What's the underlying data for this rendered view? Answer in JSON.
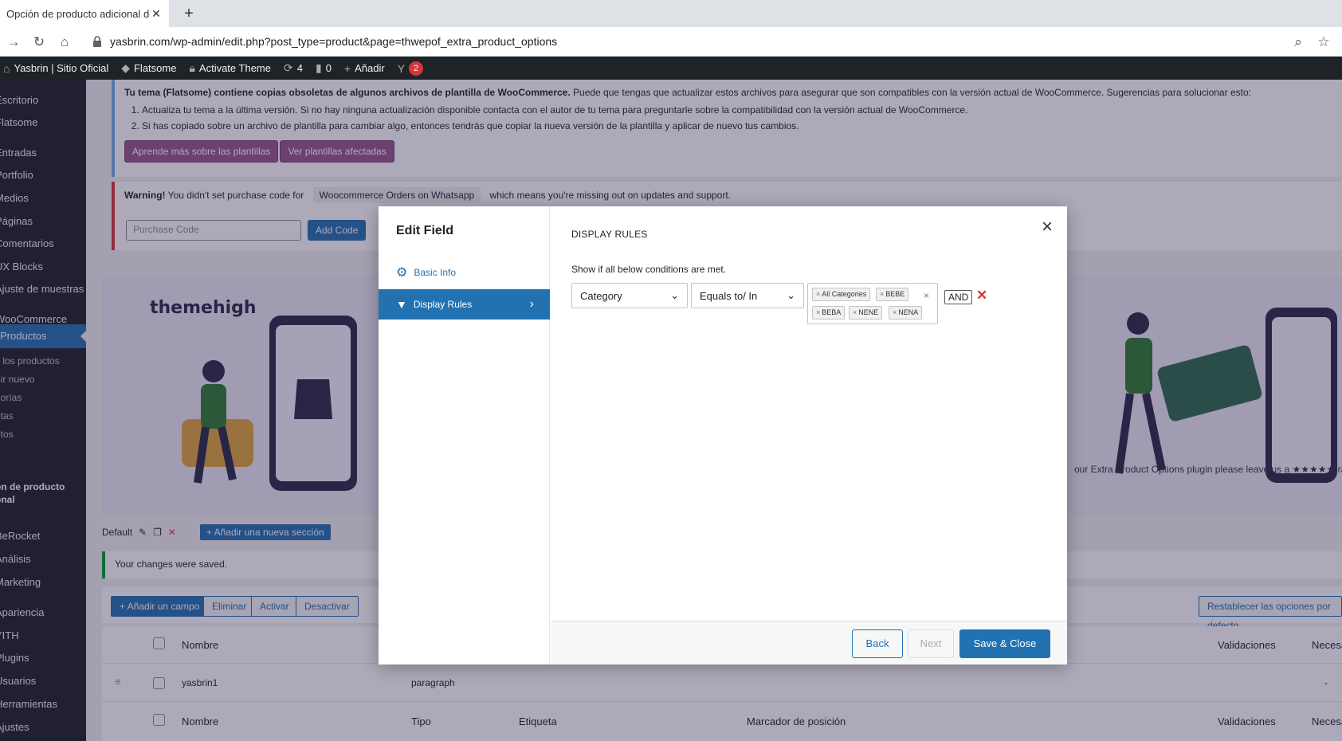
{
  "browser": {
    "tab_title": "Opción de producto adicional de",
    "url": "yasbrin.com/wp-admin/edit.php?post_type=product&page=thwepof_extra_product_options"
  },
  "adminbar": {
    "site": "Yasbrin | Sitio Oficial",
    "theme": "Flatsome",
    "activate": "Activate Theme",
    "updates": "4",
    "comments": "0",
    "add": "Añadir",
    "yoast_badge": "2"
  },
  "sidebar": {
    "items": [
      {
        "label": "Escritorio"
      },
      {
        "label": "Flatsome"
      },
      {
        "label": "Entradas"
      },
      {
        "label": "Portfolio"
      },
      {
        "label": "Medios"
      },
      {
        "label": "Páginas"
      },
      {
        "label": "Comentarios"
      },
      {
        "label": "UX Blocks"
      },
      {
        "label": "Ajuste de muestras"
      },
      {
        "label": "WooCommerce"
      },
      {
        "label": "Productos"
      },
      {
        "label": "s los productos"
      },
      {
        "label": "dir nuevo"
      },
      {
        "label": "gorías"
      },
      {
        "label": "etas"
      },
      {
        "label": "utos"
      },
      {
        "label": "ón de producto"
      },
      {
        "label": "onal"
      },
      {
        "label": "BeRocket"
      },
      {
        "label": "Análisis"
      },
      {
        "label": "Marketing"
      },
      {
        "label": "Apariencia"
      },
      {
        "label": "YITH"
      },
      {
        "label": "Plugins"
      },
      {
        "label": "Usuarios"
      },
      {
        "label": "Herramientas"
      },
      {
        "label": "Ajustes"
      }
    ]
  },
  "notice1": {
    "bold": "Tu tema (Flatsome) contiene copias obsoletas de algunos archivos de plantilla de WooCommerce.",
    "text": " Puede que tengas que actualizar estos archivos para asegurar que son compatibles con la versión actual de WooCommerce. Sugerencias para solucionar esto:",
    "li1": "Actualiza tu tema a la última versión. Si no hay ninguna actualización disponible contacta con el autor de tu tema para preguntarle sobre la compatibilidad con la versión actual de WooCommerce.",
    "li2": "Si has copiado sobre un archivo de plantilla para cambiar algo, entonces tendrás que copiar la nueva versión de la plantilla y aplicar de nuevo tus cambios.",
    "btn1": "Aprende más sobre las plantillas",
    "btn2": "Ver plantillas afectadas"
  },
  "notice2": {
    "warning": "Warning!",
    "text1": "You didn't set purchase code for",
    "plugin": "Woocommerce Orders on Whatsapp",
    "text2": "which means you're missing out on updates and support.",
    "placeholder": "Purchase Code",
    "btn": "Add Code"
  },
  "banner": {
    "logo": "themehigh",
    "text": "our Extra Product Options plugin please leave us a ★★★★★ rati"
  },
  "section": {
    "name": "Default",
    "add": "+ Añadir una nueva sección"
  },
  "saved": "Your changes were saved.",
  "toolbar": {
    "add_field": "+ Añadir un campo",
    "delete": "Eliminar",
    "activate": "Activar",
    "deactivate": "Desactivar",
    "reset": "Restablecer las opciones por defecto"
  },
  "table": {
    "h_name": "Nombre",
    "h_validations": "Validaciones",
    "h_required": "Necesario",
    "row_name": "yasbrin1",
    "row_type": "paragraph",
    "row_dash": "-",
    "f_name": "Nombre",
    "f_type": "Tipo",
    "f_label": "Etiqueta",
    "f_placeholder": "Marcador de posición",
    "f_validations": "Validaciones",
    "f_required": "Necesario"
  },
  "modal": {
    "title": "Edit Field",
    "nav_basic": "Basic Info",
    "nav_rules": "Display Rules",
    "section_title": "DISPLAY RULES",
    "desc": "Show if all below conditions are met.",
    "operand": "Category",
    "operator": "Equals to/ In",
    "values": [
      "All Categories",
      "BEBE",
      "BEBA",
      "NENE",
      "NENA"
    ],
    "and": "AND",
    "back": "Back",
    "next": "Next",
    "save": "Save & Close"
  }
}
